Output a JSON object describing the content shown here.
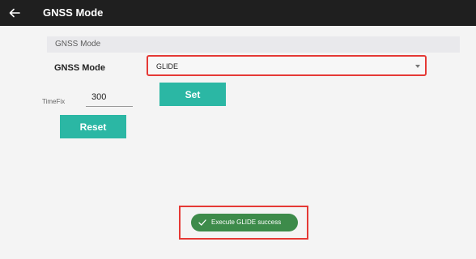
{
  "appbar": {
    "title": "GNSS Mode",
    "back_icon": "arrow-left-icon"
  },
  "section": {
    "header": "GNSS Mode"
  },
  "form": {
    "mode_label": "GNSS Mode",
    "mode_value": "GLIDE",
    "timefix_label": "TimeFix",
    "timefix_value": "300",
    "set_label": "Set",
    "reset_label": "Reset"
  },
  "toast": {
    "message": "Execute GLIDE success",
    "icon": "checkmark-icon"
  },
  "colors": {
    "appbar": "#1f1f1f",
    "button": "#2bb7a4",
    "toast": "#3d8b4a",
    "highlight": "#e53935"
  }
}
